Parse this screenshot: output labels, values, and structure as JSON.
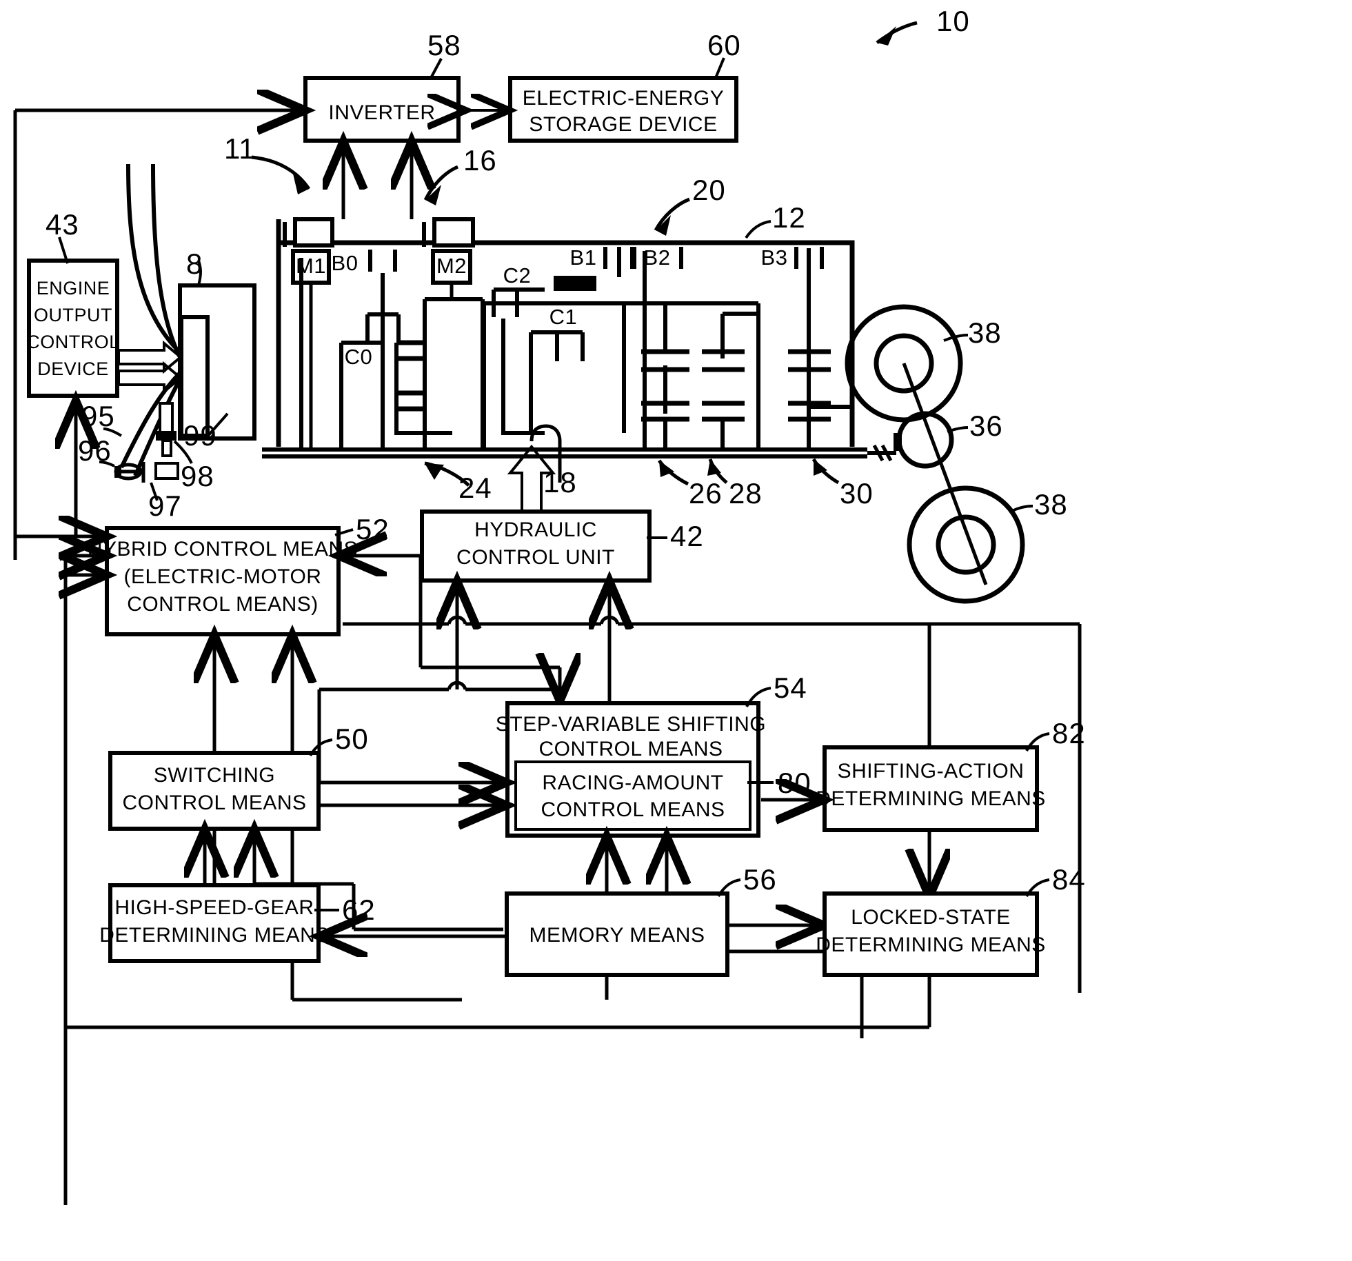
{
  "figure": {
    "id": "10",
    "type": "hybrid-vehicle-drive-control-block-diagram"
  },
  "blocks": {
    "inverter": {
      "label": "INVERTER",
      "ref": "58"
    },
    "storage": {
      "line1": "ELECTRIC-ENERGY",
      "line2": "STORAGE DEVICE",
      "ref": "60"
    },
    "engine_output": {
      "line1": "ENGINE",
      "line2": "OUTPUT",
      "line3": "CONTROL",
      "line4": "DEVICE",
      "ref": "43"
    },
    "hydraulic": {
      "line1": "HYDRAULIC",
      "line2": "CONTROL UNIT",
      "ref": "42"
    },
    "hybrid": {
      "line1": "HYBRID CONTROL MEANS",
      "line2": "(ELECTRIC-MOTOR",
      "line3": "CONTROL MEANS)",
      "ref": "52"
    },
    "switching": {
      "line1": "SWITCHING",
      "line2": "CONTROL MEANS",
      "ref": "50"
    },
    "step_variable": {
      "line1": "STEP-VARIABLE SHIFTING",
      "line2": "CONTROL MEANS",
      "ref": "54"
    },
    "racing": {
      "line1": "RACING-AMOUNT",
      "line2": "CONTROL MEANS",
      "ref": "80"
    },
    "shifting_action": {
      "line1": "SHIFTING-ACTION",
      "line2": "DETERMINING MEANS",
      "ref": "82"
    },
    "locked_state": {
      "line1": "LOCKED-STATE",
      "line2": "DETERMINING MEANS",
      "ref": "84"
    },
    "high_speed_gear": {
      "line1": "HIGH-SPEED-GEAR",
      "line2": "DETERMINING MEANS",
      "ref": "62"
    },
    "memory": {
      "line1": "MEMORY MEANS",
      "ref": "56"
    }
  },
  "motors": {
    "m1": "M1",
    "m2": "M2"
  },
  "clutches": {
    "b0": "B0",
    "c0": "C0",
    "c1": "C1",
    "c2": "C2",
    "b1": "B1",
    "b2": "B2",
    "b3": "B3"
  },
  "reference_numerals": {
    "fig": "10",
    "n11": "11",
    "n16": "16",
    "n20": "20",
    "n12": "12",
    "n8": "8",
    "n18": "18",
    "n24": "24",
    "n26": "26",
    "n28": "28",
    "n30": "30",
    "n36": "36",
    "n38a": "38",
    "n38b": "38",
    "n95": "95",
    "n96": "96",
    "n97": "97",
    "n98": "98",
    "n99": "99"
  },
  "colors": {
    "line": "#000000",
    "background": "#ffffff"
  }
}
